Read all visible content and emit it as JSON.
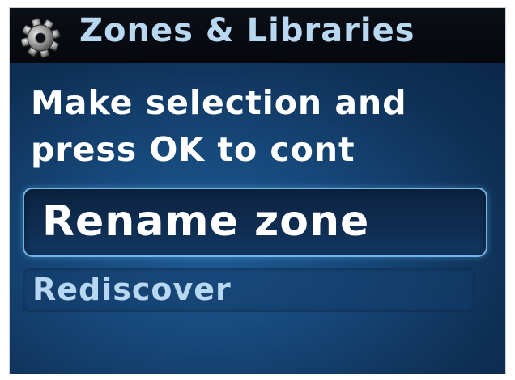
{
  "header": {
    "icon": "gear-icon",
    "title": "Zones & Libraries"
  },
  "prompt": {
    "line1": "Make selection and",
    "line2": "press OK to cont"
  },
  "menu": {
    "items": [
      {
        "label": "Rename zone",
        "selected": true
      },
      {
        "label": "Rediscover",
        "selected": false
      }
    ]
  },
  "colors": {
    "title_text": "#b8d8f2",
    "selection_border": "#6fb6e8",
    "background": "#164778"
  }
}
